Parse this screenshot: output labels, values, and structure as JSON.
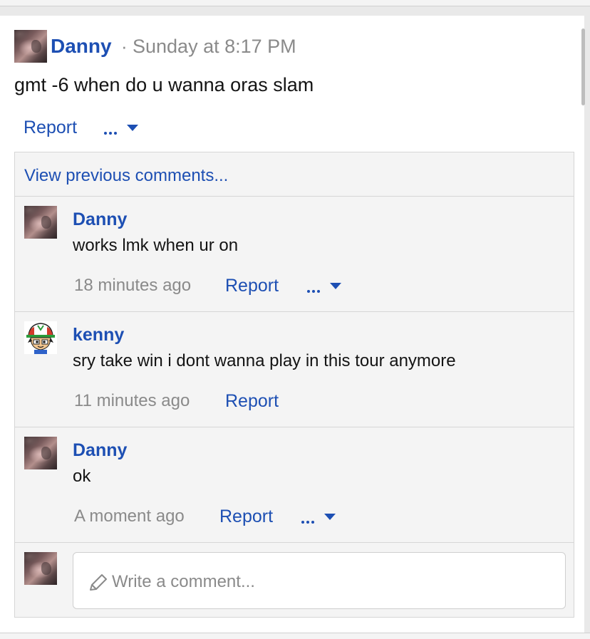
{
  "post": {
    "author": "Danny",
    "separator": "·",
    "timestamp": "Sunday at 8:17 PM",
    "text": "gmt -6 when do u wanna oras slam",
    "report_label": "Report"
  },
  "comments_section": {
    "view_previous_label": "View previous comments...",
    "comments": [
      {
        "author": "Danny",
        "text": "works lmk when ur on",
        "time": "18 minutes ago",
        "report_label": "Report",
        "has_more_menu": true
      },
      {
        "author": "kenny",
        "text": "sry take win i dont wanna play in this tour anymore",
        "time": "11 minutes ago",
        "report_label": "Report",
        "has_more_menu": false
      },
      {
        "author": "Danny",
        "text": "ok",
        "time": "A moment ago",
        "report_label": "Report",
        "has_more_menu": true
      }
    ],
    "new_comment": {
      "placeholder": "Write a comment...",
      "value": ""
    }
  },
  "icons": [
    "more-dots-icon",
    "caret-down-icon",
    "pencil-icon"
  ],
  "colors": {
    "link": "#1d4fb3",
    "muted_text": "#8a8a8a",
    "body_text": "#141414",
    "comments_bg": "#f4f4f4",
    "border": "#d6d6d6"
  }
}
